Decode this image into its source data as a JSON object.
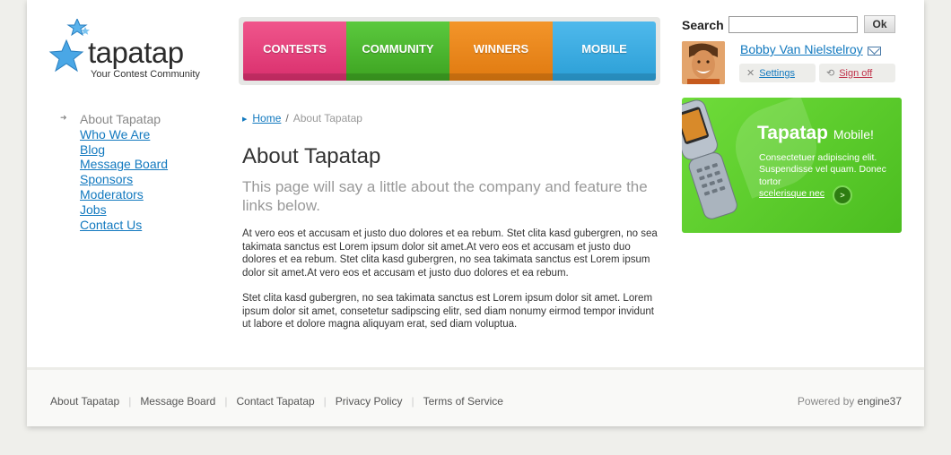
{
  "logo": {
    "wordmark": "tapatap",
    "tagline": "Your Contest Community"
  },
  "nav": {
    "items": [
      "CONTESTS",
      "COMMUNITY",
      "WINNERS",
      "MOBILE"
    ]
  },
  "search": {
    "label": "Search",
    "value": "",
    "button": "Ok"
  },
  "user": {
    "name": "Bobby Van Nielstelroy",
    "settings": "Settings",
    "signoff": "Sign off"
  },
  "sidebar": {
    "current": "About Tapatap",
    "items": [
      "Who We Are",
      "Blog",
      "Message Board",
      "Sponsors",
      "Moderators",
      "Jobs",
      "Contact Us"
    ]
  },
  "breadcrumb": {
    "home": "Home",
    "separator": "/",
    "current": "About Tapatap"
  },
  "main": {
    "title": "About Tapatap",
    "intro": "This page will say a little about the company and feature the links below.",
    "p1": "At vero eos et accusam et justo duo dolores et ea rebum. Stet clita kasd gubergren, no sea takimata sanctus est Lorem ipsum dolor sit amet.At vero eos et accusam et justo duo dolores et ea rebum. Stet clita kasd gubergren, no sea takimata sanctus est Lorem ipsum dolor sit amet.At vero eos et accusam et justo duo dolores et ea rebum.",
    "p2": "Stet clita kasd gubergren, no sea takimata sanctus est Lorem ipsum dolor sit amet. Lorem ipsum dolor sit amet, consetetur sadipscing elitr, sed diam nonumy eirmod tempor invidunt ut labore et dolore magna aliquyam erat, sed diam voluptua."
  },
  "promo": {
    "title": "Tapatap",
    "subtitle": "Mobile!",
    "text": "Consectetuer adipiscing elit. Suspendisse vel quam. Donec tortor",
    "link": "scelerisque nec",
    "button": ">"
  },
  "footer": {
    "links": [
      "About Tapatap",
      "Message Board",
      "Contact Tapatap",
      "Privacy Policy",
      "Terms of Service"
    ],
    "separator": "|",
    "powered_prefix": "Powered by",
    "powered_brand": "engine37"
  },
  "colors": {
    "contests": "#e0457c",
    "community": "#4cb72e",
    "winners": "#eb891b",
    "mobile": "#3eade2",
    "link": "#1279bf",
    "promo_green": "#5acc2c"
  },
  "icons": [
    "star-logo-icon",
    "mail-icon",
    "settings-x-icon",
    "signoff-icon",
    "sidebar-arrow-icon",
    "breadcrumb-arrow-icon",
    "promo-arrow-icon"
  ]
}
